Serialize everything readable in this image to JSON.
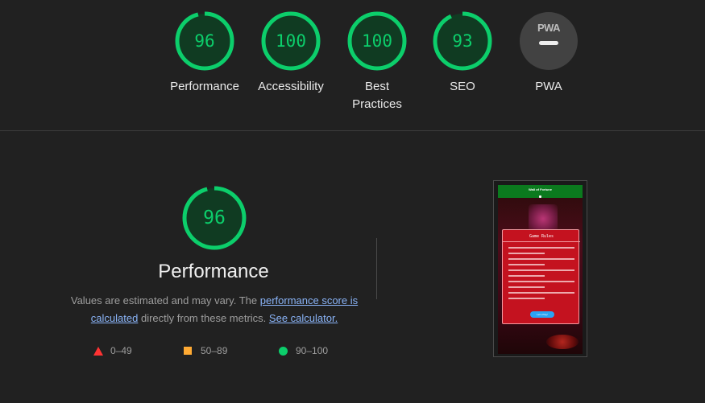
{
  "categories": [
    {
      "label": "Performance",
      "score": "96",
      "value": 96
    },
    {
      "label": "Accessibility",
      "score": "100",
      "value": 100
    },
    {
      "label": "Best\nPractices",
      "score": "100",
      "value": 100
    },
    {
      "label": "SEO",
      "score": "93",
      "value": 93
    }
  ],
  "pwa": {
    "badge": "PWA",
    "label": "PWA"
  },
  "main": {
    "score": "96",
    "value": 96,
    "title": "Performance",
    "desc_prefix": "Values are estimated and may vary. The",
    "link_score": "performance score is calculated",
    "desc_middle": "directly from these metrics.",
    "link_calc": "See calculator."
  },
  "legend": {
    "fail": "0–49",
    "average": "50–89",
    "pass": "90–100"
  },
  "thumbnail": {
    "header_title": "Wall of Fortune",
    "modal_title": "Game Rules",
    "button": "Let's Play!"
  },
  "colors": {
    "pass": "#0cce6b",
    "average": "#ffaa33",
    "fail": "#ff3333",
    "link": "#8ab4f8",
    "background": "#212121"
  }
}
